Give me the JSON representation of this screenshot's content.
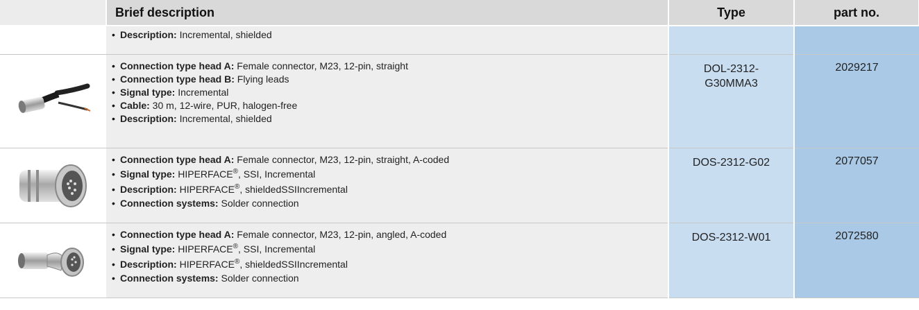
{
  "header": {
    "col_description": "Brief description",
    "col_type": "Type",
    "col_part": "part no."
  },
  "rows": [
    {
      "items": [
        {
          "label": "Description:",
          "value": " Incremental, shielded"
        }
      ]
    },
    {
      "image": "cable-with-straight-connector-photo",
      "items": [
        {
          "label": "Connection type head A:",
          "value": " Female connector, M23, 12-pin, straight"
        },
        {
          "label": "Connection type head B:",
          "value": " Flying leads"
        },
        {
          "label": "Signal type:",
          "value": " Incremental"
        },
        {
          "label": "Cable:",
          "value": " 30 m, 12-wire, PUR, halogen-free"
        },
        {
          "label": "Description:",
          "value": " Incremental, shielded"
        }
      ],
      "type_line1": "DOL-2312-",
      "type_line2": "G30MMA3",
      "part": "2029217"
    },
    {
      "image": "straight-female-connector-photo",
      "items": [
        {
          "label": "Connection type head A:",
          "value": " Female connector, M23, 12-pin, straight, A-coded"
        },
        {
          "label": "Signal type:",
          "value_a": " HIPERFACE",
          "sup": "®",
          "value_b": ", SSI, Incremental"
        },
        {
          "label": "Description:",
          "value_a": " HIPERFACE",
          "sup": "®",
          "value_b": ", shieldedSSIIncremental"
        },
        {
          "label": "Connection systems:",
          "value": " Solder connection"
        }
      ],
      "type": "DOS-2312-G02",
      "part": "2077057"
    },
    {
      "image": "angled-female-connector-photo",
      "items": [
        {
          "label": "Connection type head A:",
          "value": " Female connector, M23, 12-pin, angled, A-coded"
        },
        {
          "label": "Signal type:",
          "value_a": " HIPERFACE",
          "sup": "®",
          "value_b": ", SSI, Incremental"
        },
        {
          "label": "Description:",
          "value_a": " HIPERFACE",
          "sup": "®",
          "value_b": ", shieldedSSIIncremental"
        },
        {
          "label": "Connection systems:",
          "value": " Solder connection"
        }
      ],
      "type": "DOS-2312-W01",
      "part": "2072580"
    }
  ]
}
